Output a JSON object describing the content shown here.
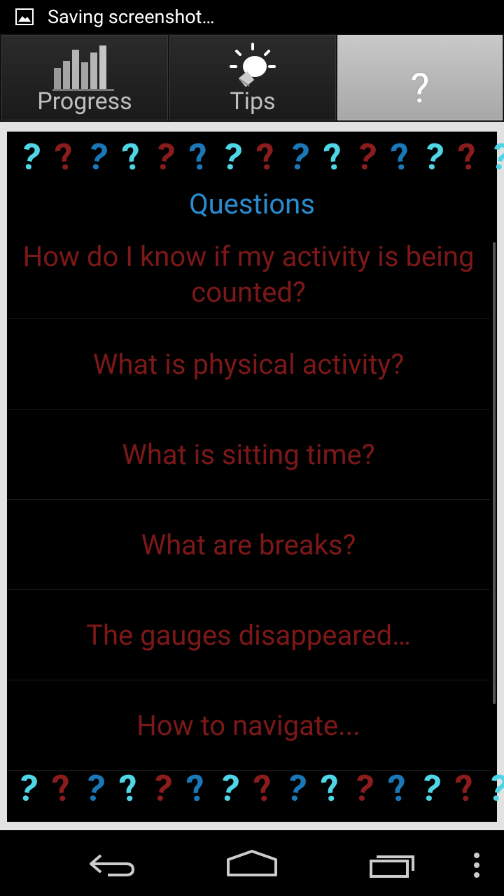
{
  "status_bar": {
    "text": "Saving screenshot…"
  },
  "tabs": [
    {
      "label": "Progress",
      "icon": "bar-chart-icon",
      "active": false
    },
    {
      "label": "Tips",
      "icon": "lightbulb-icon",
      "active": false
    },
    {
      "label": "?",
      "icon": "question-mark",
      "active": true
    }
  ],
  "panel": {
    "title": "Questions",
    "decoration_glyph": "?",
    "questions": [
      {
        "text": "How do I know if my activity is being counted?"
      },
      {
        "text": "What is physical activity?"
      },
      {
        "text": "What is sitting time?"
      },
      {
        "text": "What are breaks?"
      },
      {
        "text": "The gauges disappeared…"
      },
      {
        "text": "How to navigate..."
      }
    ]
  },
  "colors": {
    "question_text": "#7c1818",
    "title_blue": "#2a8bd0",
    "deco_cyan": "#4fd6e6",
    "deco_red": "#8a1c1c",
    "deco_blue": "#1a78b8",
    "active_tab": "#b9b9b9"
  },
  "nav_bar": {
    "back": "back-icon",
    "home": "home-icon",
    "recents": "recents-icon",
    "menu": "overflow-menu-icon"
  }
}
